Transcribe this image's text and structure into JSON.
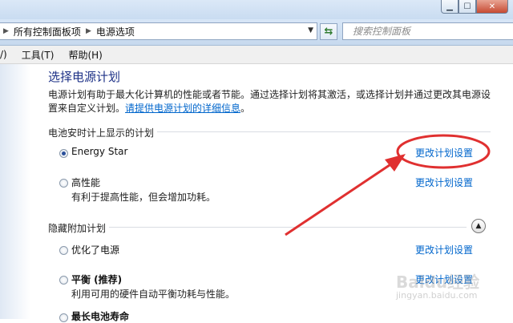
{
  "window": {
    "minimize_icon": "minimize-icon",
    "maximize_icon": "maximize-icon",
    "close_icon": "close-icon"
  },
  "address": {
    "segments": [
      "所有控制面板项",
      "电源选项"
    ],
    "search_placeholder": "搜索控制面板"
  },
  "menu": {
    "items": [
      "/)",
      "工具(T)",
      "帮助(H)"
    ]
  },
  "main": {
    "title": "选择电源计划",
    "description": "电源计划有助于最大化计算机的性能或者节能。通过选择计划将其激活，或选择计划并通过更改其电源设置来自定义计划。",
    "description_link": "请提供电源计划的详细信息",
    "description_end": "。"
  },
  "battery_section": {
    "label": "电池安时计上显示的计划",
    "plans": [
      {
        "name": "Energy Star",
        "desc": "",
        "checked": true,
        "link": "更改计划设置"
      },
      {
        "name": "高性能",
        "desc": "有利于提高性能，但会增加功耗。",
        "checked": false,
        "link": "更改计划设置"
      }
    ]
  },
  "hidden_section": {
    "label": "隐藏附加计划",
    "plans": [
      {
        "name": "优化了电源",
        "desc": "",
        "checked": false,
        "link": "更改计划设置"
      },
      {
        "name": "平衡 (推荐)",
        "desc": "利用可用的硬件自动平衡功耗与性能。",
        "checked": false,
        "link": "更改计划设置"
      },
      {
        "name": "最长电池寿命",
        "desc": "",
        "checked": false,
        "link": ""
      }
    ]
  },
  "annotation_color": "#e03030",
  "watermark": {
    "text": "Baidu经验",
    "sub": "jingyan.baidu.com"
  }
}
